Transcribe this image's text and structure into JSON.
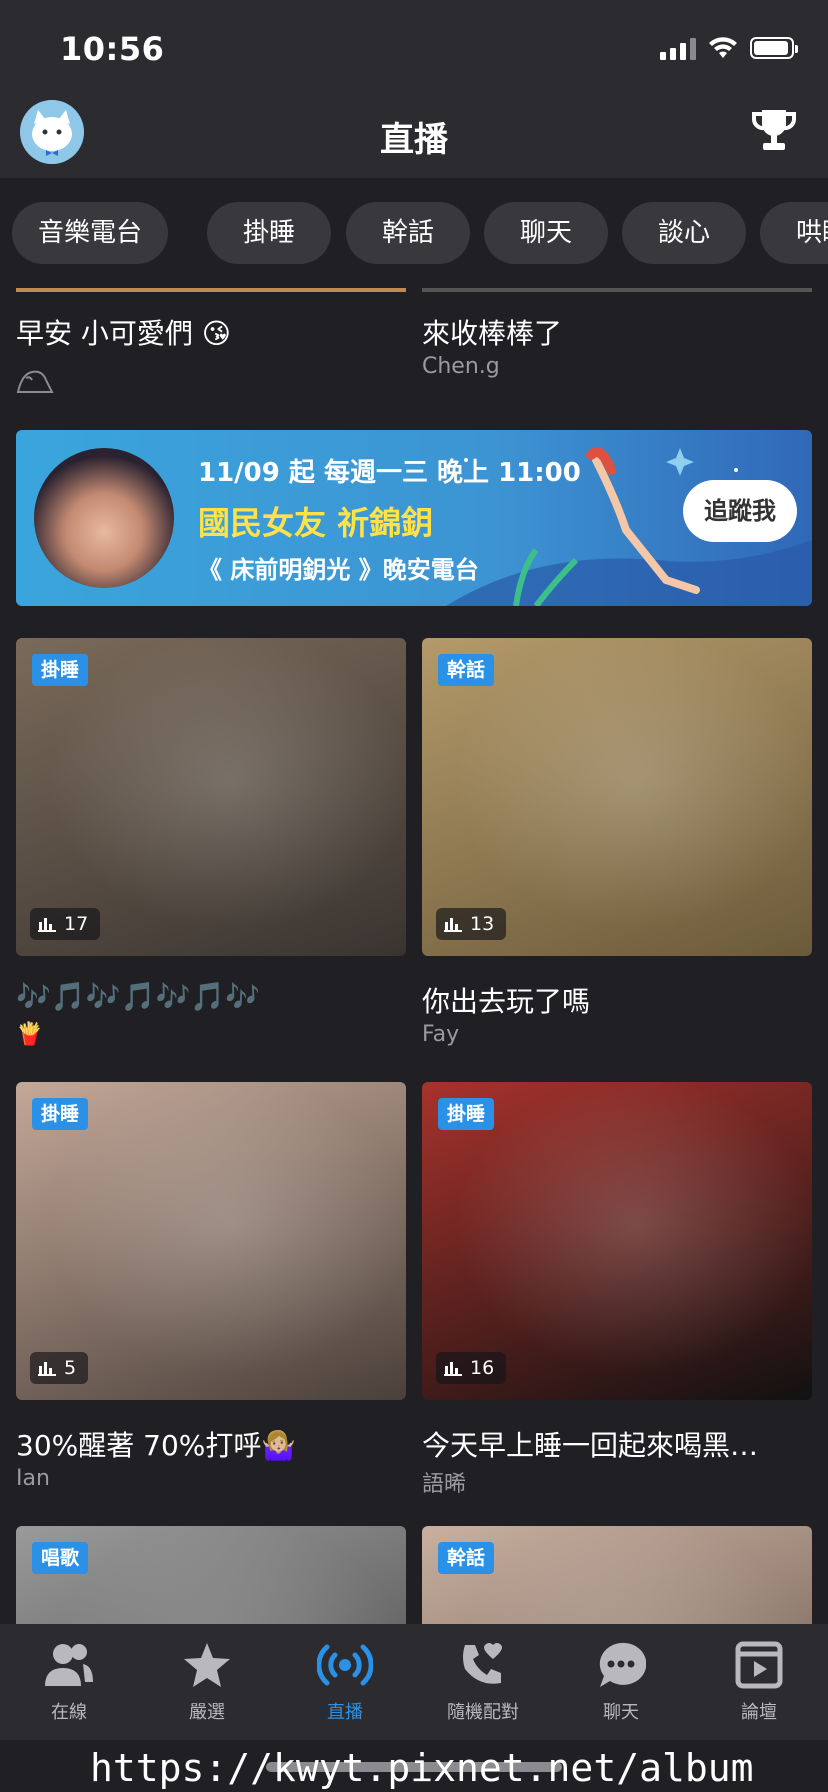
{
  "status_bar": {
    "time": "10:56"
  },
  "header": {
    "title": "直播"
  },
  "categories": [
    "音樂電台",
    "掛睡",
    "幹話",
    "聊天",
    "談心",
    "哄睡"
  ],
  "top_row": [
    {
      "title": "早安 小可愛們 😘",
      "author": ""
    },
    {
      "title": "來收棒棒了",
      "author": "Chen.g"
    }
  ],
  "banner": {
    "schedule": "11/09 起 每週一三 晚上 11:00",
    "headline": "國民女友 祈錦鈅",
    "program": "《 床前明鈅光 》晚安電台",
    "follow_button": "追蹤我"
  },
  "cards": [
    {
      "tag": "掛睡",
      "listeners": "17",
      "title": "🎶🎵🎶🎵🎶🎵🎶",
      "author": "🍟",
      "colors": [
        "#3a3430",
        "#7a6a5a"
      ]
    },
    {
      "tag": "幹話",
      "listeners": "13",
      "title": "你出去玩了嗎",
      "author": "Fay",
      "colors": [
        "#6b5a3a",
        "#b49a6a"
      ]
    },
    {
      "tag": "掛睡",
      "listeners": "5",
      "title": "30%醒著 70%打呼🤷🏼‍♀️",
      "author": "Ian",
      "colors": [
        "#4a403a",
        "#c4a898"
      ]
    },
    {
      "tag": "掛睡",
      "listeners": "16",
      "title": "今天早上睡一回起來喝黑…",
      "author": "語晞",
      "colors": [
        "#111111",
        "#a8322c"
      ]
    },
    {
      "tag": "唱歌",
      "listeners": "",
      "title": "",
      "author": "",
      "colors": [
        "#3a3a3a",
        "#9a9a9a"
      ]
    },
    {
      "tag": "幹話",
      "listeners": "",
      "title": "",
      "author": "",
      "colors": [
        "#5a4a40",
        "#c9b0a0"
      ]
    }
  ],
  "tabs": [
    {
      "label": "在線",
      "icon": "users-icon"
    },
    {
      "label": "嚴選",
      "icon": "star-icon"
    },
    {
      "label": "直播",
      "icon": "broadcast-icon",
      "active": true
    },
    {
      "label": "隨機配對",
      "icon": "phone-heart-icon"
    },
    {
      "label": "聊天",
      "icon": "chat-icon"
    },
    {
      "label": "論壇",
      "icon": "forum-icon"
    }
  ],
  "watermark": "https://kwyt.pixnet.net/album",
  "colors": {
    "accent": "#2a91e6",
    "background": "#1f1f24",
    "bar": "#2c2c30"
  }
}
